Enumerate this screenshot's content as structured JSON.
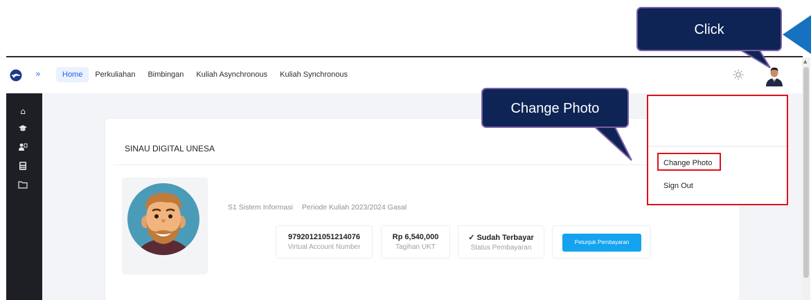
{
  "navbar": {
    "items": [
      {
        "label": "Home"
      },
      {
        "label": "Perkuliahan"
      },
      {
        "label": "Bimbingan"
      },
      {
        "label": "Kuliah Asynchronous"
      },
      {
        "label": "Kuliah Synchronous"
      }
    ],
    "expand_icon": "double-chevron-right-icon"
  },
  "sidebar": {
    "icons": [
      "home-icon",
      "graduation-cap-icon",
      "user-teacher-icon",
      "calculator-icon",
      "folder-icon"
    ]
  },
  "card": {
    "title": "SINAU DIGITAL UNESA",
    "program": "S1 Sistem Informasi",
    "period": "Periode Kuliah 2023/2024 Gasal",
    "va_number": "97920121051214076",
    "va_label": "Virtual Account Number",
    "tuition": "Rp 6,540,000",
    "tuition_label": "Tagihan UKT",
    "status": "✓ Sudah Terbayar",
    "status_label": "Status Pembayaran",
    "button": "Petunjuk Pembayaran"
  },
  "dropdown": {
    "items": [
      {
        "label": "Change Photo"
      },
      {
        "label": "Sign Out"
      }
    ]
  },
  "callouts": {
    "click": "Click",
    "change_photo": "Change Photo"
  },
  "colors": {
    "accent": "#2563eb",
    "button": "#14a3ee",
    "sidebar": "#1d1f24",
    "highlight": "#e0101a",
    "callout": "#0e2455"
  }
}
